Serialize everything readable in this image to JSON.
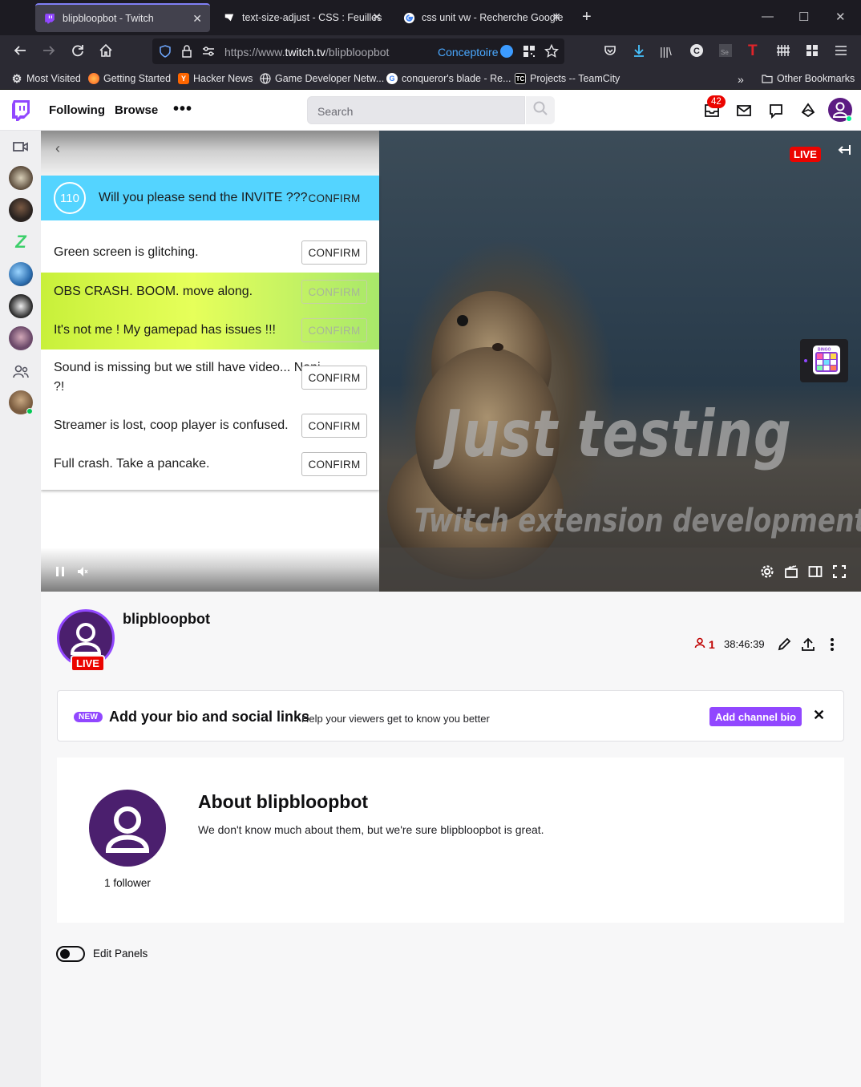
{
  "browser": {
    "tabs": [
      {
        "title": "blipbloopbot - Twitch",
        "active": true
      },
      {
        "title": "text-size-adjust - CSS : Feuilles d",
        "active": false
      },
      {
        "title": "css unit vw - Recherche Google",
        "active": false
      }
    ],
    "url_prefix": "https://www.",
    "url_domain": "twitch.tv",
    "url_path": "/blipbloopbot",
    "container_label": "Conceptoire",
    "bookmarks": [
      {
        "label": "Most Visited",
        "icon": "gear-icon"
      },
      {
        "label": "Getting Started",
        "icon": "firefox-icon"
      },
      {
        "label": "Hacker News",
        "icon": "y-icon"
      },
      {
        "label": "Game Developer Netw...",
        "icon": "globe-icon"
      },
      {
        "label": "conqueror's blade - Re...",
        "icon": "google-icon"
      },
      {
        "label": "Projects -- TeamCity",
        "icon": "tc-icon"
      }
    ],
    "other_bookmarks": "Other Bookmarks"
  },
  "twitch": {
    "nav": {
      "following": "Following",
      "browse": "Browse",
      "more": "•••",
      "search_placeholder": "Search",
      "inbox_badge": "42"
    },
    "player": {
      "live": "LIVE",
      "overlay_title": "Just testing",
      "overlay_subtitle": "Twitch extension development"
    },
    "bingo": {
      "header": {
        "count": "110",
        "text": "Will you please send the INVITE ???",
        "button": "CONFIRM"
      },
      "items": [
        {
          "text": "Green screen is glitching.",
          "button": "CONFIRM"
        },
        {
          "text": "OBS CRASH. BOOM. move along.",
          "button": "CONFIRM"
        },
        {
          "text": "It's not me ! My gamepad has issues !!!",
          "button": "CONFIRM"
        },
        {
          "text": "Sound is missing but we still have video... Nani ?!",
          "button": "CONFIRM"
        },
        {
          "text": "Streamer is lost, coop player is confused.",
          "button": "CONFIRM"
        },
        {
          "text": "Full crash. Take a pancake.",
          "button": "CONFIRM"
        }
      ],
      "highlight_color": "#d9ff4a",
      "header_color": "#54d4ff"
    },
    "channel": {
      "name": "blipbloopbot",
      "live": "LIVE",
      "viewers": "1",
      "uptime": "38:46:39"
    },
    "bio": {
      "new": "NEW",
      "title": "Add your bio and social links",
      "subtitle": "Help your viewers get to know you better",
      "button": "Add channel bio",
      "close": "✕"
    },
    "about": {
      "title": "About blipbloopbot",
      "description": "We don't know much about them, but we're sure blipbloopbot is great.",
      "followers": "1 follower"
    },
    "edit_panels": "Edit Panels",
    "brand_color": "#9147ff"
  }
}
